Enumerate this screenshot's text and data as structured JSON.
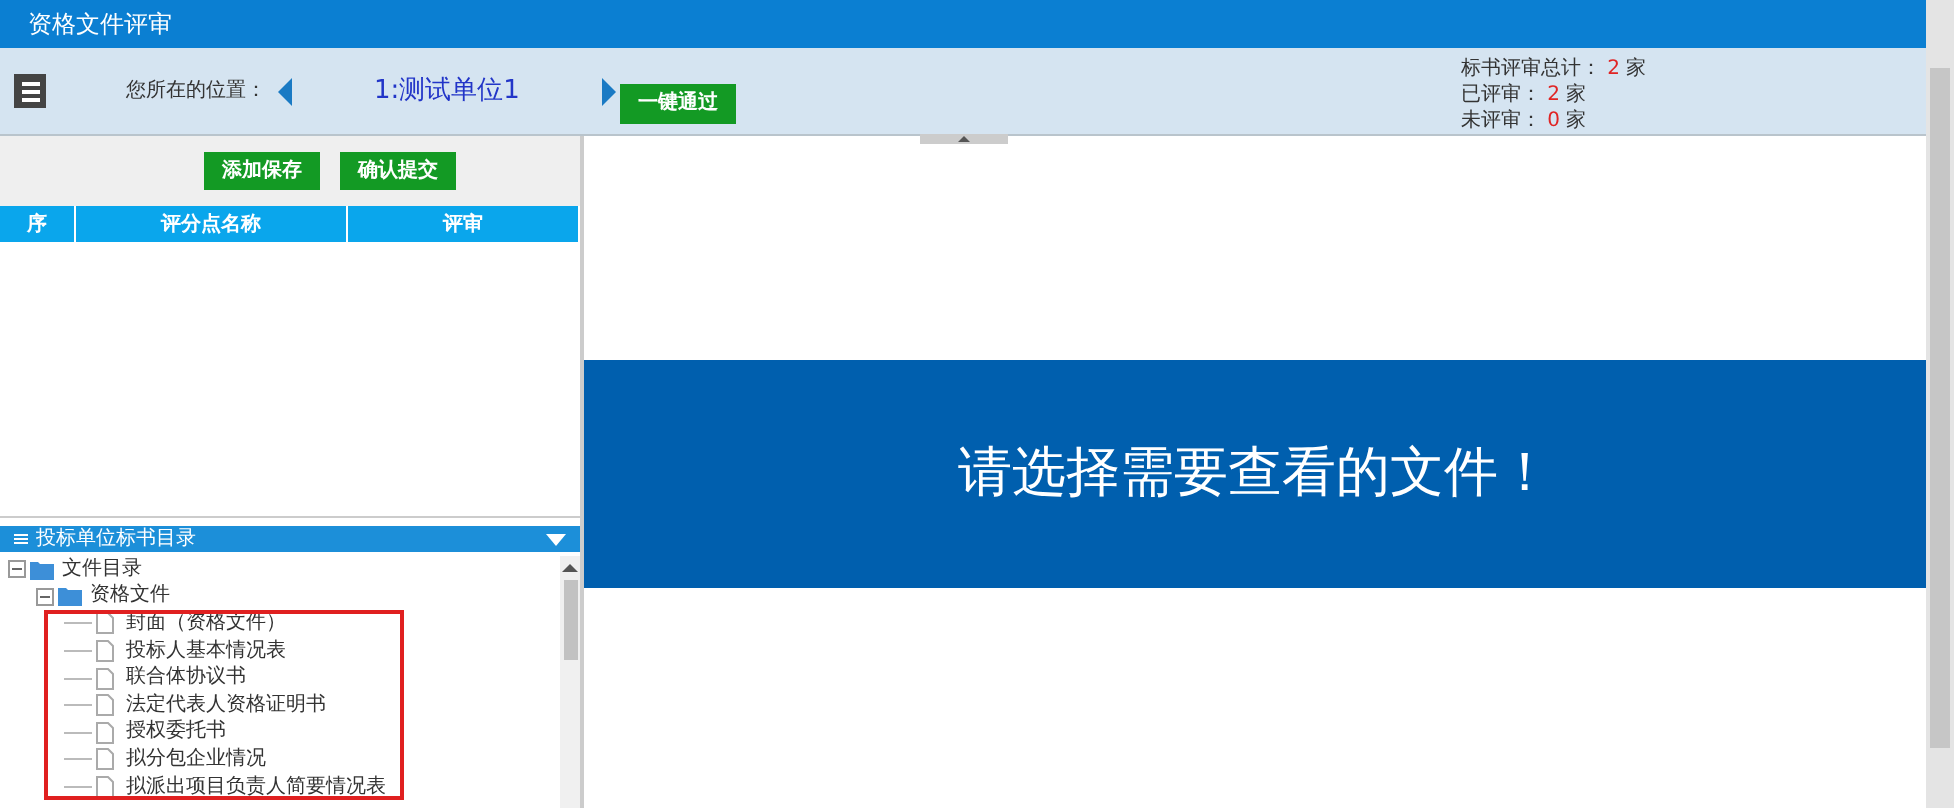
{
  "window": {
    "title": "资格文件评审"
  },
  "header": {
    "location_label": "您所在的位置：",
    "current_unit": "1:测试单位1",
    "pass_all_button": "一键通过",
    "stats": [
      {
        "label": "标书评审总计：",
        "count": "2",
        "unit": "家"
      },
      {
        "label": "已评审：",
        "count": "2",
        "unit": "家"
      },
      {
        "label": "未评审：",
        "count": "0",
        "unit": "家"
      }
    ]
  },
  "left_panel": {
    "buttons": [
      "添加保存",
      "确认提交"
    ],
    "table": {
      "columns": [
        "序",
        "评分点名称",
        "评审"
      ]
    },
    "tree_title": "投标单位标书目录",
    "tree": [
      {
        "label": "文件目录",
        "kind": "folder",
        "expanded": true,
        "children": [
          {
            "label": "资格文件",
            "kind": "folder",
            "expanded": true,
            "children": [
              {
                "label": "封面（资格文件）",
                "kind": "file"
              },
              {
                "label": "投标人基本情况表",
                "kind": "file"
              },
              {
                "label": "联合体协议书",
                "kind": "file"
              },
              {
                "label": "法定代表人资格证明书",
                "kind": "file"
              },
              {
                "label": "授权委托书",
                "kind": "file"
              },
              {
                "label": "拟分包企业情况",
                "kind": "file"
              },
              {
                "label": "拟派出项目负责人简要情况表",
                "kind": "file"
              }
            ]
          }
        ]
      }
    ]
  },
  "viewer": {
    "message": "请选择需要查看的文件！"
  }
}
